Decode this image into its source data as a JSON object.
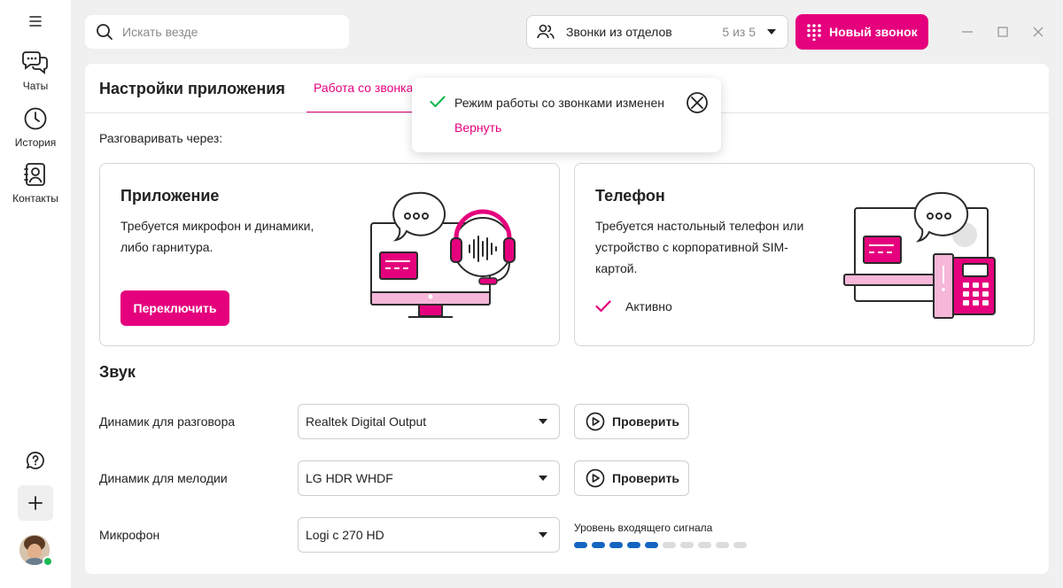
{
  "sidebar": {
    "items": [
      {
        "label": "Чаты",
        "icon": "chat-icon"
      },
      {
        "label": "История",
        "icon": "clock-icon"
      },
      {
        "label": "Контакты",
        "icon": "contacts-icon"
      }
    ]
  },
  "topbar": {
    "search_placeholder": "Искать везде",
    "dept_filter": {
      "label": "Звонки из отделов",
      "count": "5 из 5"
    },
    "new_call_label": "Новый звонок"
  },
  "settings": {
    "title": "Настройки приложения",
    "active_tab": "Работа со звонками",
    "talk_via_label": "Разговаривать через:",
    "modes": {
      "app": {
        "title": "Приложение",
        "description": "Требуется микрофон и динамики, либо гарнитура.",
        "button_label": "Переключить"
      },
      "phone": {
        "title": "Телефон",
        "description": "Требуется настольный телефон или устройство с корпоративной SIM-картой.",
        "status_label": "Активно"
      }
    },
    "sound": {
      "title": "Звук",
      "rows": [
        {
          "label": "Динамик для разговора",
          "value": "Realtek Digital Output",
          "check_label": "Проверить"
        },
        {
          "label": "Динамик для мелодии",
          "value": "LG HDR WHDF",
          "check_label": "Проверить"
        },
        {
          "label": "Микрофон",
          "value": "Logi c 270 HD"
        }
      ],
      "level_label": "Уровень входящего сигнала",
      "level_value": 5,
      "level_max": 10
    }
  },
  "toast": {
    "message": "Режим работы со звонками изменен",
    "undo_label": "Вернуть"
  },
  "colors": {
    "accent": "#e5007d",
    "success": "#1db954",
    "level": "#1565c0"
  }
}
